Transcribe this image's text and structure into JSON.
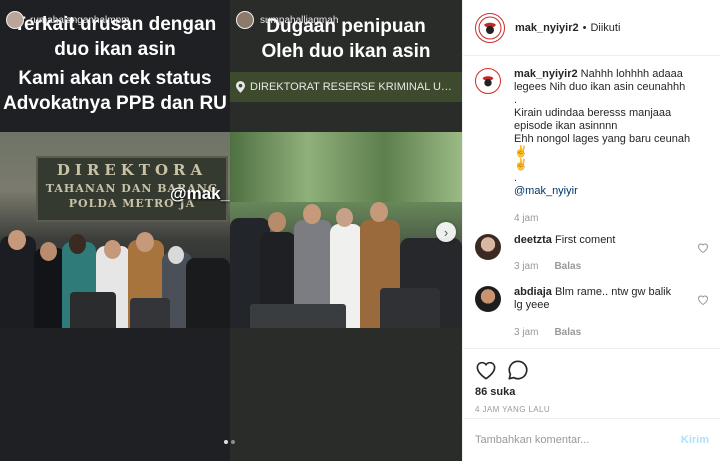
{
  "media": {
    "left_story": {
      "username": "rumahalanganhalmpm",
      "headline_line1": "Terkait urusan dengan",
      "headline_line2": "duo ikan asin",
      "headline_line3": "Kami akan cek status",
      "headline_line4": "Advokatnya PPB dan RU",
      "sign_line1": "DIREKTORA",
      "sign_line2": "TAHANAN DAN BARANG",
      "sign_line3": "POLDA METRO JA",
      "watermark": "@mak_nyiyir"
    },
    "right_story": {
      "username": "sumpahalliagmah",
      "headline_line1": "Dugaan penipuan",
      "headline_line2": "Oleh duo ikan asin",
      "location": "DIREKTORAT RESERSE KRIMINAL UMUM PO..."
    },
    "next_arrow_icon": "chevron-right-icon"
  },
  "post": {
    "username": "mak_nyiyir2",
    "separator": "•",
    "follow_status": "Diikuti",
    "caption": {
      "username": "mak_nyiyir2",
      "line1": "Nahhh lohhhh adaaa",
      "line2": "legees Nih duo ikan asin ceunahhh",
      "line3": ".",
      "line4": "Kirain udindaa beresss manjaaa",
      "line5": "episode ikan asinnnn",
      "line6": "Ehh nongol lages yang baru ceunah✌",
      "line7": "✌",
      "line8": ".",
      "mention": "@mak_nyiyir",
      "time": "4 jam"
    },
    "comments": [
      {
        "username": "deetzta",
        "text": "First coment",
        "time": "3 jam",
        "reply_label": "Balas"
      },
      {
        "username": "abdiaja",
        "text": "Blm rame.. ntw gw balik",
        "text2": "lg yeee",
        "time": "3 jam",
        "reply_label": "Balas"
      }
    ],
    "likes": "86 suka",
    "time_ago": "4 JAM YANG LALU",
    "comment_placeholder": "Tambahkan komentar...",
    "post_button": "Kirim"
  },
  "colors": {
    "link": "#003569",
    "post_button": "#b2dffc",
    "muted": "#999999",
    "border": "#efefef"
  }
}
